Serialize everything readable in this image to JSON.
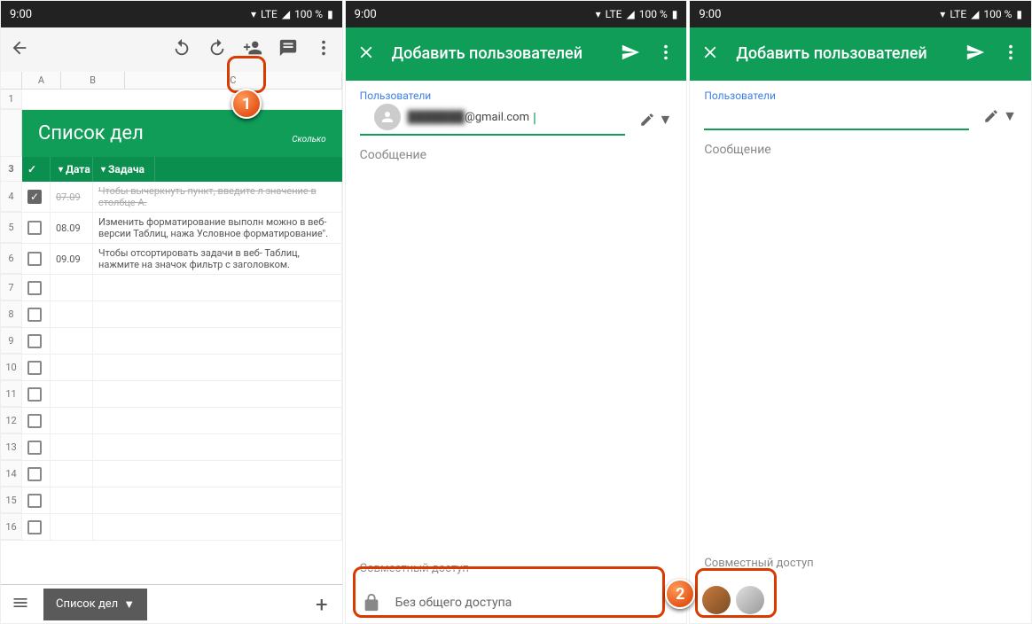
{
  "status": {
    "time": "9:00",
    "net": "LTE",
    "battery": "100 %"
  },
  "phone1": {
    "sheet_title": "Список дел",
    "subtitle": "Сколько",
    "columns": {
      "a": "A",
      "b": "B",
      "c": "C"
    },
    "header": {
      "check": "✓",
      "date": "Дата",
      "task": "Задача"
    },
    "rows": [
      {
        "n": "1"
      },
      {
        "n": "3"
      },
      {
        "n": "4",
        "checked": true,
        "date": "07.09",
        "task": "Чтобы вычеркнуть пункт, введите л значение в столбце А."
      },
      {
        "n": "5",
        "checked": false,
        "date": "08.09",
        "task": "Изменить форматирование выполн можно в веб-версии Таблиц, нажа Условное форматирование\"."
      },
      {
        "n": "6",
        "checked": false,
        "date": "09.09",
        "task": "Чтобы отсортировать задачи в веб- Таблиц, нажмите на значок фильтр с заголовком."
      },
      {
        "n": "7"
      },
      {
        "n": "8"
      },
      {
        "n": "9"
      },
      {
        "n": "10"
      },
      {
        "n": "11"
      },
      {
        "n": "12"
      },
      {
        "n": "13"
      },
      {
        "n": "14"
      },
      {
        "n": "15"
      },
      {
        "n": "16"
      }
    ],
    "tab_name": "Список дел"
  },
  "share": {
    "title": "Добавить пользователей",
    "users_label": "Пользователи",
    "email_suffix": "@gmail.com",
    "message_label": "Сообщение",
    "access_label": "Совместный доступ",
    "no_access": "Без общего доступа"
  },
  "markers": {
    "m1": "1",
    "m2": "2"
  }
}
